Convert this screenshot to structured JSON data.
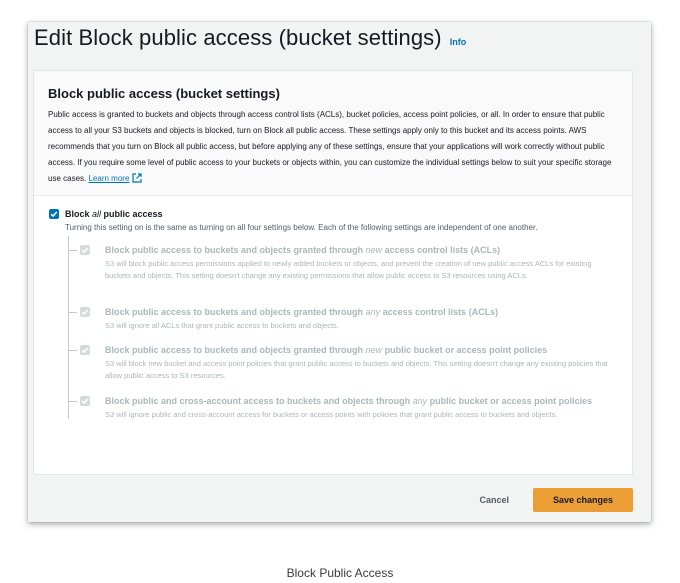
{
  "header": {
    "title": "Edit Block public access (bucket settings)",
    "info_label": "Info"
  },
  "panel": {
    "title": "Block public access (bucket settings)",
    "description": "Public access is granted to buckets and objects through access control lists (ACLs), bucket policies, access point policies, or all. In order to ensure that public access to all your S3 buckets and objects is blocked, turn on Block all public access. These settings apply only to this bucket and its access points. AWS recommends that you turn on Block all public access, but before applying any of these settings, ensure that your applications will work correctly without public access. If you require some level of public access to your buckets or objects within, you can customize the individual settings below to suit your specific storage use cases.",
    "learn_more": "Learn more"
  },
  "master": {
    "label_pre": "Block ",
    "label_em": "all",
    "label_post": " public access",
    "description": "Turning this setting on is the same as turning on all four settings below. Each of the following settings are independent of one another.",
    "checked": true
  },
  "options": [
    {
      "title_pre": "Block public access to buckets and objects granted through ",
      "title_em": "new",
      "title_post": " access control lists (ACLs)",
      "description": "S3 will block public access permissions applied to newly added buckets or objects, and prevent the creation of new public access ACLs for existing buckets and objects. This setting doesn't change any existing permissions that allow public access to S3 resources using ACLs.",
      "checked": true
    },
    {
      "title_pre": "Block public access to buckets and objects granted through ",
      "title_em": "any",
      "title_post": " access control lists (ACLs)",
      "description": "S3 will ignore all ACLs that grant public access to buckets and objects.",
      "checked": true
    },
    {
      "title_pre": "Block public access to buckets and objects granted through ",
      "title_em": "new",
      "title_post": " public bucket or access point policies",
      "description": "S3 will block new bucket and access point policies that grant public access to buckets and objects. This setting doesn't change any existing policies that allow public access to S3 resources.",
      "checked": true
    },
    {
      "title_pre": "Block public and cross-account access to buckets and objects through ",
      "title_em": "any",
      "title_post": " public bucket or access point policies",
      "description": "S3 will ignore public and cross-account access for buckets or access points with policies that grant public access to buckets and objects.",
      "checked": true
    }
  ],
  "footer": {
    "cancel_label": "Cancel",
    "save_label": "Save changes"
  },
  "caption": "Block Public Access",
  "colors": {
    "accent": "#0073bb",
    "primary_button": "#ec9e37",
    "disabled_text": "#aab7b8"
  }
}
